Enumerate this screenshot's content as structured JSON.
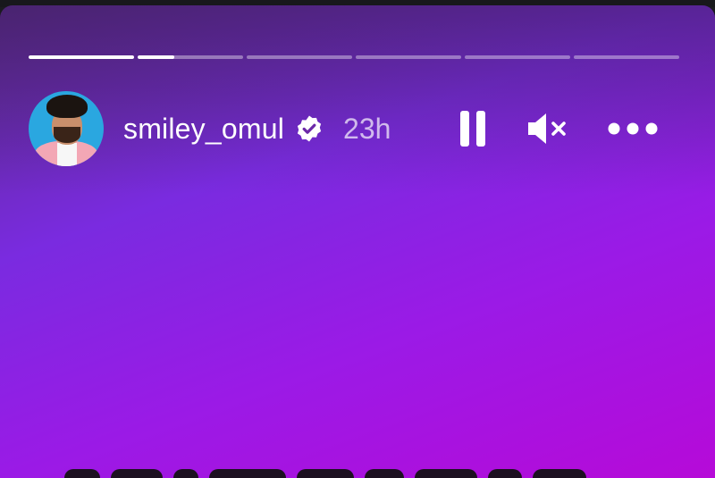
{
  "story": {
    "username": "smiley_omul",
    "verified": true,
    "timestamp": "23h",
    "segments": [
      {
        "progress": 1.0
      },
      {
        "progress": 0.35
      },
      {
        "progress": 0.0
      },
      {
        "progress": 0.0
      },
      {
        "progress": 0.0
      },
      {
        "progress": 0.0
      }
    ],
    "controls": {
      "pause_icon": "pause-icon",
      "mute_icon": "muted-speaker-icon",
      "more_icon": "more-options-icon"
    },
    "colors": {
      "gradient_start": "#5a2a8a",
      "gradient_mid": "#7a2be0",
      "gradient_end": "#b60ad8",
      "text": "#ffffff"
    }
  }
}
